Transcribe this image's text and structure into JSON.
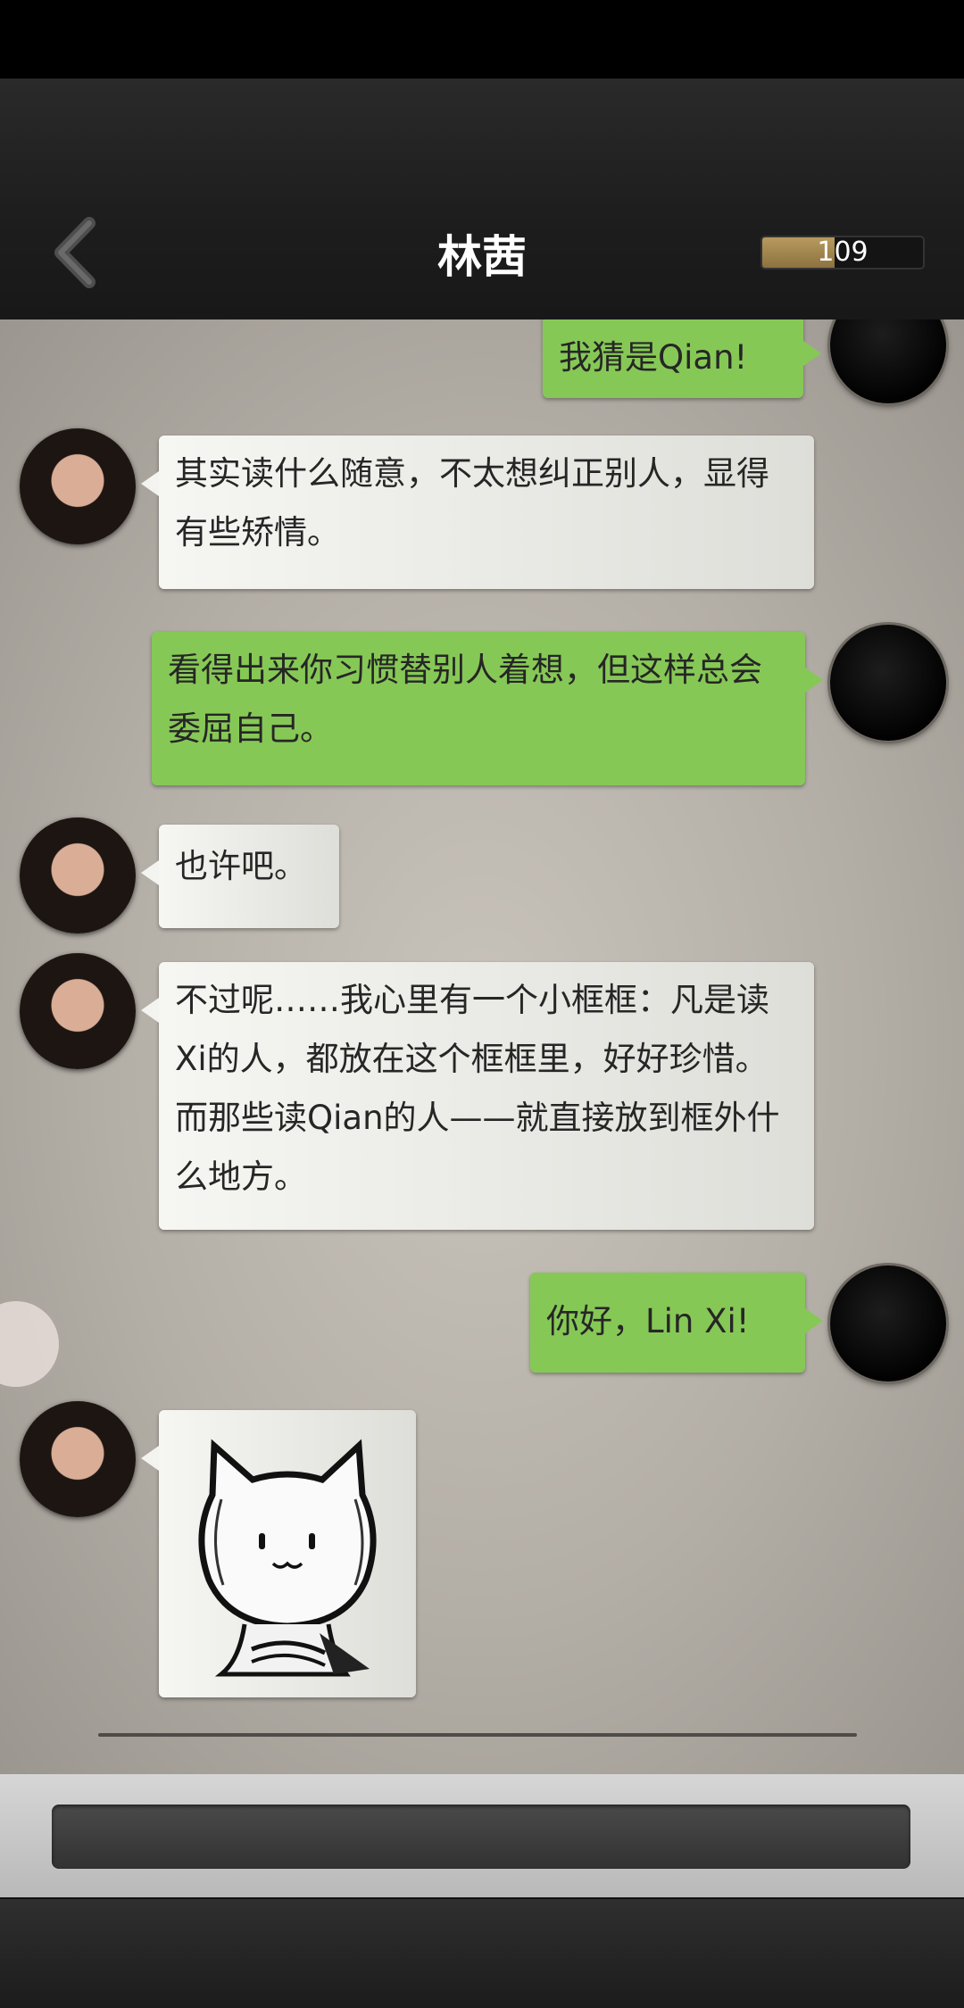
{
  "header": {
    "title": "林茜",
    "score": "109",
    "score_fill_percent": 45,
    "back_icon": "chevron-left-icon"
  },
  "messages": [
    {
      "sender": "me",
      "text": "我猜是Qian!"
    },
    {
      "sender": "linqian",
      "text": "其实读什么随意，不太想纠正别人，显得有些矫情。"
    },
    {
      "sender": "me",
      "text": "看得出来你习惯替别人着想，但这样总会委屈自己。"
    },
    {
      "sender": "linqian",
      "text": "也许吧。"
    },
    {
      "sender": "linqian",
      "text": "不过呢……我心里有一个小框框：凡是读Xi的人，都放在这个框框里，好好珍惜。而那些读Qian的人——就直接放到框外什么地方。"
    },
    {
      "sender": "me",
      "text": "你好，Lin Xi!"
    },
    {
      "sender": "linqian",
      "sticker": "cat-sticker-icon"
    }
  ],
  "colors": {
    "outgoing_bubble": "#86c856",
    "incoming_bubble": "#f3f3f0",
    "header": "#1f1f1f",
    "score_fill": "#a78850"
  },
  "input": {
    "placeholder": ""
  }
}
